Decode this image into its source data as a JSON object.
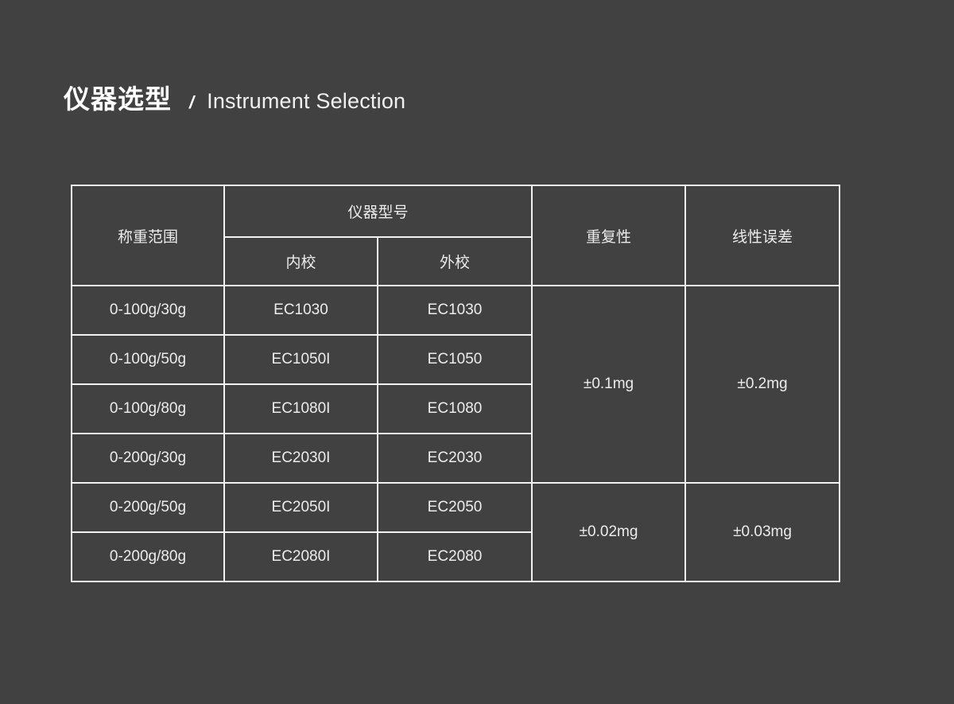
{
  "heading": {
    "title_cn": "仪器选型",
    "separator": "/",
    "title_en": "Instrument Selection"
  },
  "colors": {
    "background": "#414141",
    "border": "#f2f2f2",
    "text": "#ececec",
    "title": "#ffffff"
  },
  "table": {
    "headers": {
      "weighing_range": "称重范围",
      "instrument_model": "仪器型号",
      "internal_calibration": "内校",
      "external_calibration": "外校",
      "repeatability": "重复性",
      "linearity_error": "线性误差"
    },
    "rows": [
      {
        "range": "0-100g/30g",
        "internal": "EC1030",
        "external": "EC1030"
      },
      {
        "range": "0-100g/50g",
        "internal": "EC1050I",
        "external": "EC1050"
      },
      {
        "range": "0-100g/80g",
        "internal": "EC1080I",
        "external": "EC1080"
      },
      {
        "range": "0-200g/30g",
        "internal": "EC2030I",
        "external": "EC2030"
      },
      {
        "range": "0-200g/50g",
        "internal": "EC2050I",
        "external": "EC2050"
      },
      {
        "range": "0-200g/80g",
        "internal": "EC2080I",
        "external": "EC2080"
      }
    ],
    "groups": [
      {
        "span": 4,
        "repeatability": "±0.1mg",
        "linearity": "±0.2mg"
      },
      {
        "span": 2,
        "repeatability": "±0.02mg",
        "linearity": "±0.03mg"
      }
    ]
  }
}
